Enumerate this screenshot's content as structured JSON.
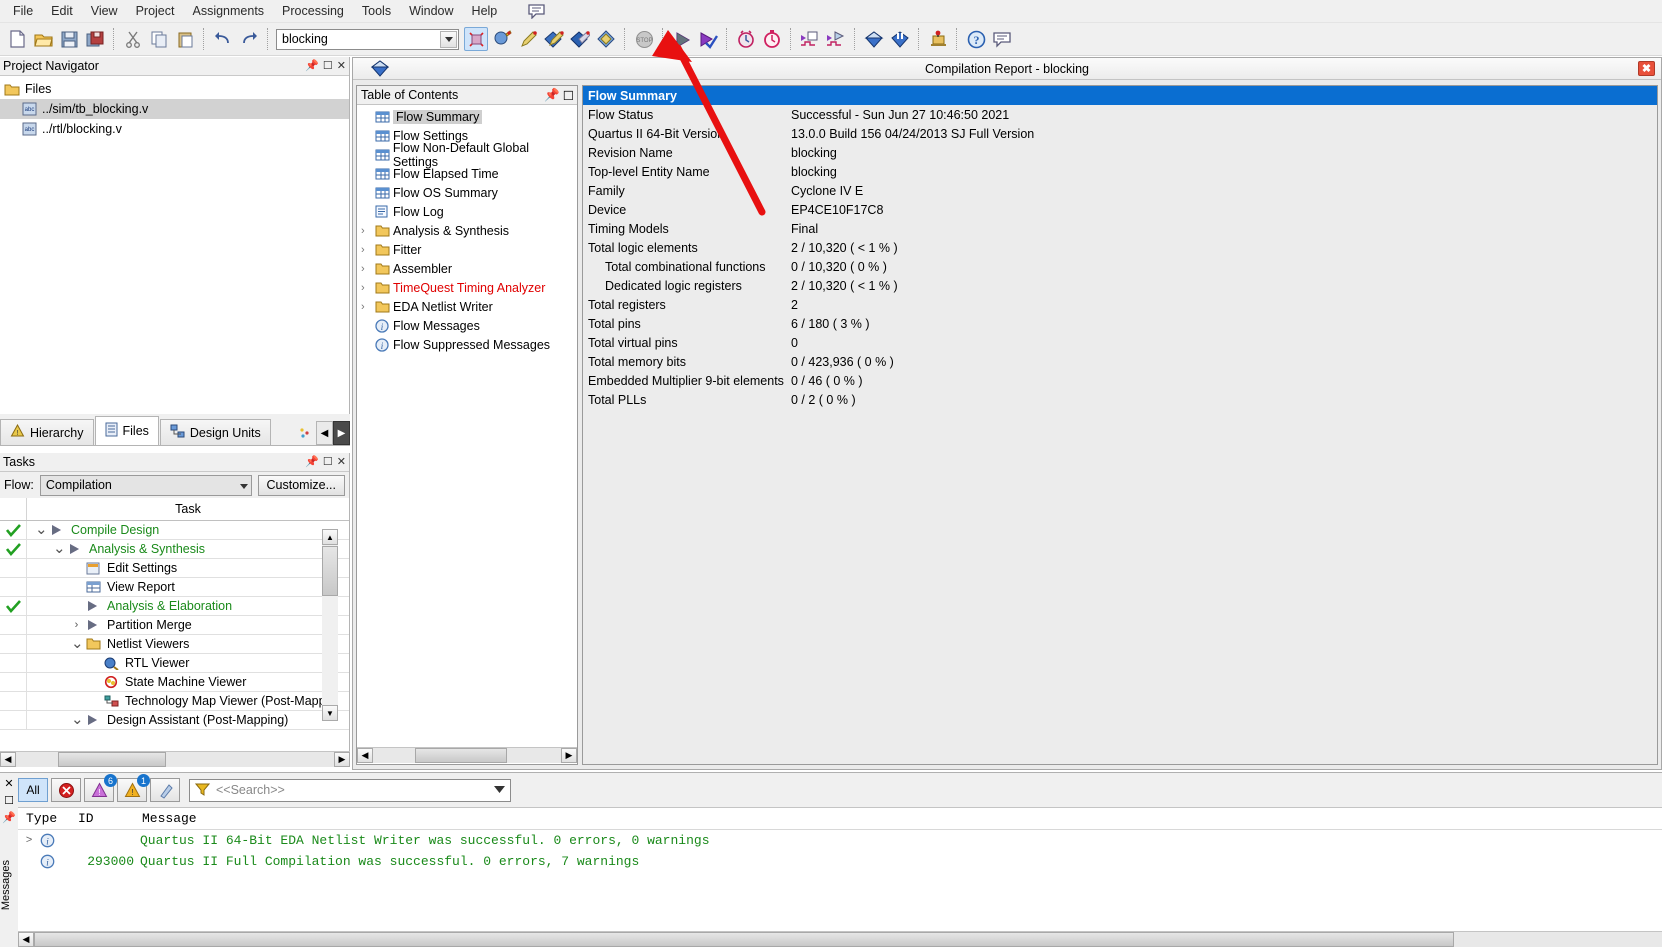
{
  "menu": {
    "items": [
      "File",
      "Edit",
      "View",
      "Project",
      "Assignments",
      "Processing",
      "Tools",
      "Window",
      "Help"
    ],
    "speech_icon": "speech-bubble-icon"
  },
  "toolbar": {
    "revision_value": "blocking",
    "buttons": [
      {
        "name": "new-file-icon",
        "glyph": "□"
      },
      {
        "name": "open-file-icon",
        "glyph": "📂"
      },
      {
        "name": "save-file-icon",
        "glyph": "💾"
      },
      {
        "name": "save-all-icon",
        "glyph": "🖫"
      },
      {
        "name": "cut-icon",
        "glyph": "✂"
      },
      {
        "name": "copy-icon",
        "glyph": "❐"
      },
      {
        "name": "paste-icon",
        "glyph": "📋"
      },
      {
        "name": "undo-icon",
        "glyph": "↶"
      },
      {
        "name": "redo-icon",
        "glyph": "↷"
      }
    ]
  },
  "project_navigator": {
    "title": "Project Navigator",
    "root": "Files",
    "files": [
      {
        "label": "../sim/tb_blocking.v",
        "selected": true
      },
      {
        "label": "../rtl/blocking.v",
        "selected": false
      }
    ]
  },
  "nav_tabs": [
    {
      "label": "Hierarchy",
      "icon": "hierarchy-icon",
      "selected": false
    },
    {
      "label": "Files",
      "icon": "files-icon",
      "selected": true
    },
    {
      "label": "Design Units",
      "icon": "design-units-icon",
      "selected": false
    }
  ],
  "tasks_panel": {
    "title": "Tasks",
    "flow_label": "Flow:",
    "flow_value": "Compilation",
    "customize_label": "Customize...",
    "column_header": "Task",
    "rows": [
      {
        "label": "Compile Design",
        "indent": 0,
        "check": true,
        "expander": "v",
        "icon": "play-icon",
        "green": true
      },
      {
        "label": "Analysis & Synthesis",
        "indent": 1,
        "check": true,
        "expander": "v",
        "icon": "play-icon",
        "green": true
      },
      {
        "label": "Edit Settings",
        "indent": 2,
        "check": false,
        "expander": "",
        "icon": "settings-icon",
        "green": false
      },
      {
        "label": "View Report",
        "indent": 2,
        "check": false,
        "expander": "",
        "icon": "report-icon",
        "green": false
      },
      {
        "label": "Analysis & Elaboration",
        "indent": 2,
        "check": true,
        "expander": "",
        "icon": "play-icon",
        "green": true
      },
      {
        "label": "Partition Merge",
        "indent": 2,
        "check": false,
        "expander": ">",
        "icon": "play-icon",
        "green": false
      },
      {
        "label": "Netlist Viewers",
        "indent": 2,
        "check": false,
        "expander": "v",
        "icon": "folder-icon",
        "green": false
      },
      {
        "label": "RTL Viewer",
        "indent": 3,
        "check": false,
        "expander": "",
        "icon": "rtl-viewer-icon",
        "green": false
      },
      {
        "label": "State Machine Viewer",
        "indent": 3,
        "check": false,
        "expander": "",
        "icon": "state-machine-icon",
        "green": false
      },
      {
        "label": "Technology Map Viewer (Post-Mapp",
        "indent": 3,
        "check": false,
        "expander": "",
        "icon": "tech-map-icon",
        "green": false
      },
      {
        "label": "Design Assistant (Post-Mapping)",
        "indent": 2,
        "check": false,
        "expander": "v",
        "icon": "play-icon",
        "green": false
      }
    ]
  },
  "report_window": {
    "title": "Compilation Report - blocking",
    "icon": "report-window-icon",
    "close_label": "✖"
  },
  "toc": {
    "title": "Table of Contents",
    "items": [
      {
        "label": "Flow Summary",
        "icon": "table-icon",
        "expander": "",
        "selected": true,
        "red": false
      },
      {
        "label": "Flow Settings",
        "icon": "table-icon",
        "expander": "",
        "selected": false,
        "red": false
      },
      {
        "label": "Flow Non-Default Global Settings",
        "icon": "table-icon",
        "expander": "",
        "selected": false,
        "red": false
      },
      {
        "label": "Flow Elapsed Time",
        "icon": "table-icon",
        "expander": "",
        "selected": false,
        "red": false
      },
      {
        "label": "Flow OS Summary",
        "icon": "table-icon",
        "expander": "",
        "selected": false,
        "red": false
      },
      {
        "label": "Flow Log",
        "icon": "log-icon",
        "expander": "",
        "selected": false,
        "red": false
      },
      {
        "label": "Analysis & Synthesis",
        "icon": "folder-icon",
        "expander": ">",
        "selected": false,
        "red": false
      },
      {
        "label": "Fitter",
        "icon": "folder-icon",
        "expander": ">",
        "selected": false,
        "red": false
      },
      {
        "label": "Assembler",
        "icon": "folder-icon",
        "expander": ">",
        "selected": false,
        "red": false
      },
      {
        "label": "TimeQuest Timing Analyzer",
        "icon": "folder-icon",
        "expander": ">",
        "selected": false,
        "red": true
      },
      {
        "label": "EDA Netlist Writer",
        "icon": "folder-icon",
        "expander": ">",
        "selected": false,
        "red": false
      },
      {
        "label": "Flow Messages",
        "icon": "info-icon",
        "expander": "",
        "selected": false,
        "red": false
      },
      {
        "label": "Flow Suppressed Messages",
        "icon": "info-icon",
        "expander": "",
        "selected": false,
        "red": false
      }
    ]
  },
  "flow_summary": {
    "header": "Flow Summary",
    "rows": [
      {
        "key": "Flow Status",
        "value": "Successful - Sun Jun 27 10:46:50 2021",
        "indent": false
      },
      {
        "key": "Quartus II 64-Bit Version",
        "value": "13.0.0 Build 156 04/24/2013 SJ Full Version",
        "indent": false
      },
      {
        "key": "Revision Name",
        "value": "blocking",
        "indent": false
      },
      {
        "key": "Top-level Entity Name",
        "value": "blocking",
        "indent": false
      },
      {
        "key": "Family",
        "value": "Cyclone IV E",
        "indent": false
      },
      {
        "key": "Device",
        "value": "EP4CE10F17C8",
        "indent": false
      },
      {
        "key": "Timing Models",
        "value": "Final",
        "indent": false
      },
      {
        "key": "Total logic elements",
        "value": "2 / 10,320 ( < 1 % )",
        "indent": false
      },
      {
        "key": "Total combinational functions",
        "value": "0 / 10,320 ( 0 % )",
        "indent": true
      },
      {
        "key": "Dedicated logic registers",
        "value": "2 / 10,320 ( < 1 % )",
        "indent": true
      },
      {
        "key": "Total registers",
        "value": "2",
        "indent": false
      },
      {
        "key": "Total pins",
        "value": "6 / 180 ( 3 % )",
        "indent": false
      },
      {
        "key": "Total virtual pins",
        "value": "0",
        "indent": false
      },
      {
        "key": "Total memory bits",
        "value": "0 / 423,936 ( 0 % )",
        "indent": false
      },
      {
        "key": "Embedded Multiplier 9-bit elements",
        "value": "0 / 46 ( 0 % )",
        "indent": false
      },
      {
        "key": "Total PLLs",
        "value": "0 / 2 ( 0 % )",
        "indent": false
      }
    ]
  },
  "messages": {
    "side_label": "Messages",
    "filters": [
      {
        "name": "all-filter",
        "label": "All",
        "badge": "",
        "active": true
      },
      {
        "name": "error-filter",
        "label": "",
        "badge": "",
        "active": false
      },
      {
        "name": "critical-warning-filter",
        "label": "",
        "badge": "6",
        "active": false
      },
      {
        "name": "warning-filter",
        "label": "",
        "badge": "1",
        "active": false
      },
      {
        "name": "info-filter",
        "label": "",
        "badge": "",
        "active": false
      }
    ],
    "search_placeholder": "<<Search>>",
    "columns": [
      "Type",
      "ID",
      "Message"
    ],
    "rows": [
      {
        "expander": ">",
        "icon": "info-icon",
        "id": "",
        "text": "Quartus II 64-Bit EDA Netlist Writer was successful. 0 errors, 0 warnings"
      },
      {
        "expander": "",
        "icon": "info-icon",
        "id": "293000",
        "text": "Quartus II Full Compilation was successful. 0 errors, 7 warnings"
      }
    ]
  },
  "annotation": {
    "name": "red-arrow-pointing-to-start-compilation",
    "color": "#e81010"
  }
}
